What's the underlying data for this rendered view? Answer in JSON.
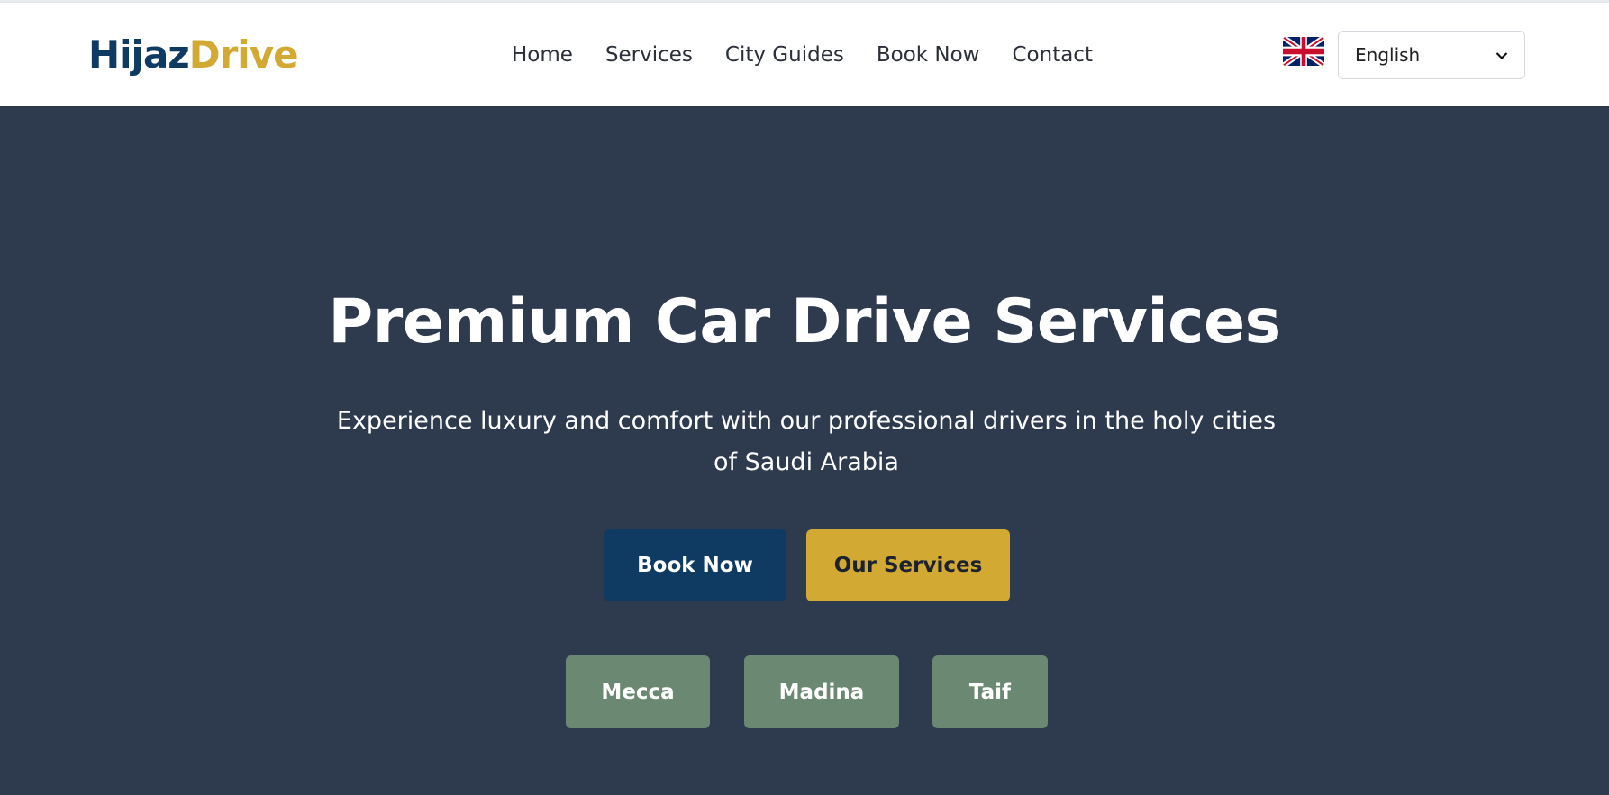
{
  "header": {
    "logo_part1": "Hijaz",
    "logo_part2": "Drive",
    "nav": [
      "Home",
      "Services",
      "City Guides",
      "Book Now",
      "Contact"
    ],
    "language": {
      "flag_icon": "uk-flag-icon",
      "selected": "English"
    }
  },
  "hero": {
    "title": "Premium Car Drive Services",
    "subtitle": "Experience luxury and comfort with our professional drivers in the holy cities of Saudi Arabia",
    "primary_button": "Book Now",
    "secondary_button": "Our Services",
    "cities": [
      "Mecca",
      "Madina",
      "Taif"
    ]
  },
  "colors": {
    "brand_navy": "#0f3b63",
    "brand_gold": "#d2aa33",
    "hero_bg": "#2e3a4e",
    "city_green": "#6b8872"
  }
}
